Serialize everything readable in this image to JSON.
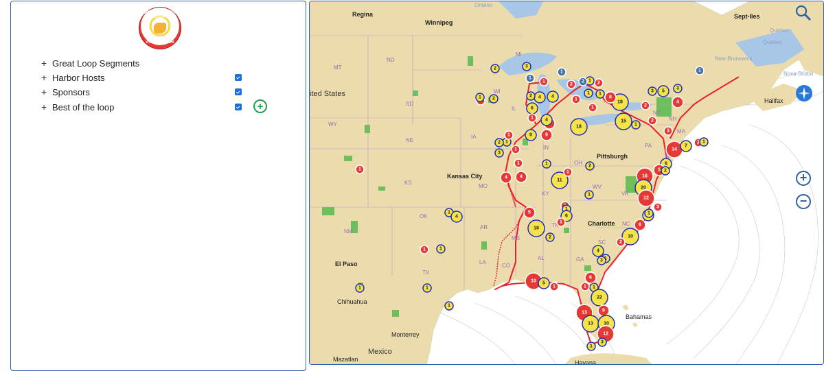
{
  "logo": {
    "top_text": "AMERICA'S GREAT LOOP",
    "bottom_text": "CRUISERS' ASSOCIATION"
  },
  "layers": [
    {
      "label": "Great Loop Segments",
      "checkbox": null
    },
    {
      "label": "Harbor Hosts",
      "checkbox": true
    },
    {
      "label": "Sponsors",
      "checkbox": true
    },
    {
      "label": "Best of the loop",
      "checkbox": true
    }
  ],
  "add_button": "+",
  "colors": {
    "land": "#ecdcad",
    "water": "#ffffff",
    "lake": "#a8c7e6",
    "route": "#e8202a",
    "harbor_host": "#e53935",
    "sponsor": "#4a6fa5",
    "best_of_loop": "#f6e34a",
    "park": "#6cbf5b"
  },
  "map": {
    "cities": [
      "Regina",
      "Winnipeg",
      "Sept-Iles",
      "Kansas City",
      "Pittsburgh",
      "Charlotte",
      "El Paso",
      "Chihuahua",
      "Monterrey",
      "Mexico",
      "Mazatlan",
      "Halifax",
      "Havana",
      "Bahamas",
      "Ontario",
      "Quebec",
      "Quebec",
      "New Brunswick",
      "Nova Scotia",
      "ited States"
    ],
    "states": [
      "MT",
      "ND",
      "MI",
      "SD",
      "WY",
      "WI",
      "NE",
      "IA",
      "IN",
      "OH",
      "PA",
      "NY",
      "NH",
      "MA",
      "NJ",
      "KS",
      "MO",
      "KY",
      "WV",
      "VA",
      "NM",
      "OK",
      "AR",
      "TN",
      "NC",
      "SC",
      "MS",
      "AL",
      "GA",
      "TX",
      "LA",
      "CO",
      "IL"
    ],
    "markers": [
      {
        "kind": "best",
        "n": "2"
      },
      {
        "kind": "best",
        "n": "3"
      },
      {
        "kind": "sponsor",
        "n": "1"
      },
      {
        "kind": "host",
        "n": "1"
      },
      {
        "kind": "best",
        "n": "1"
      },
      {
        "kind": "host",
        "n": "2"
      },
      {
        "kind": "sponsor",
        "n": "2"
      },
      {
        "kind": "host",
        "n": "2"
      },
      {
        "kind": "best",
        "n": "1"
      },
      {
        "kind": "best",
        "n": "1"
      },
      {
        "kind": "host",
        "n": "1"
      },
      {
        "kind": "host",
        "n": "1"
      },
      {
        "kind": "best",
        "n": "4"
      },
      {
        "kind": "best",
        "n": "4"
      },
      {
        "kind": "best",
        "n": "6"
      },
      {
        "kind": "host",
        "n": "1"
      },
      {
        "kind": "host",
        "n": "4"
      },
      {
        "kind": "best",
        "n": "18"
      },
      {
        "kind": "host",
        "n": "8"
      },
      {
        "kind": "best",
        "n": "18"
      },
      {
        "kind": "best",
        "n": "15"
      },
      {
        "kind": "host",
        "n": "2"
      },
      {
        "kind": "host",
        "n": "2"
      },
      {
        "kind": "best",
        "n": "3"
      },
      {
        "kind": "best",
        "n": "5"
      },
      {
        "kind": "best",
        "n": "3"
      },
      {
        "kind": "sponsor",
        "n": "1"
      },
      {
        "kind": "host",
        "n": "4"
      },
      {
        "kind": "host",
        "n": "9"
      },
      {
        "kind": "best",
        "n": "1"
      },
      {
        "kind": "best",
        "n": "3"
      },
      {
        "kind": "host",
        "n": "4"
      },
      {
        "kind": "host",
        "n": "1"
      },
      {
        "kind": "host",
        "n": "1"
      },
      {
        "kind": "host",
        "n": "4"
      },
      {
        "kind": "best",
        "n": "6"
      },
      {
        "kind": "host",
        "n": "3"
      },
      {
        "kind": "best",
        "n": "1"
      },
      {
        "kind": "host",
        "n": "14"
      },
      {
        "kind": "best",
        "n": "7"
      },
      {
        "kind": "host",
        "n": "2"
      },
      {
        "kind": "best",
        "n": "1"
      },
      {
        "kind": "host",
        "n": "16"
      },
      {
        "kind": "host",
        "n": "5"
      },
      {
        "kind": "best",
        "n": "2"
      },
      {
        "kind": "best",
        "n": "20"
      },
      {
        "kind": "host",
        "n": "12"
      },
      {
        "kind": "best",
        "n": "4"
      },
      {
        "kind": "best",
        "n": "1"
      },
      {
        "kind": "best",
        "n": "1"
      },
      {
        "kind": "best",
        "n": "11"
      },
      {
        "kind": "host",
        "n": "1"
      },
      {
        "kind": "best",
        "n": "1"
      },
      {
        "kind": "best",
        "n": "2"
      },
      {
        "kind": "host",
        "n": "1"
      },
      {
        "kind": "host",
        "n": "5"
      },
      {
        "kind": "best",
        "n": "1"
      },
      {
        "kind": "best",
        "n": "18"
      },
      {
        "kind": "best",
        "n": "6"
      },
      {
        "kind": "host",
        "n": "1"
      },
      {
        "kind": "best",
        "n": "2"
      },
      {
        "kind": "host",
        "n": "6"
      },
      {
        "kind": "host",
        "n": "3"
      },
      {
        "kind": "best",
        "n": "10"
      },
      {
        "kind": "host",
        "n": "2"
      },
      {
        "kind": "best",
        "n": "1"
      },
      {
        "kind": "best",
        "n": "4"
      },
      {
        "kind": "best",
        "n": "3"
      },
      {
        "kind": "best",
        "n": "1"
      },
      {
        "kind": "host",
        "n": "1"
      },
      {
        "kind": "host",
        "n": "10"
      },
      {
        "kind": "best",
        "n": "5"
      },
      {
        "kind": "host",
        "n": "6"
      },
      {
        "kind": "host",
        "n": "1"
      },
      {
        "kind": "best",
        "n": "22"
      },
      {
        "kind": "host",
        "n": "13"
      },
      {
        "kind": "host",
        "n": "9"
      },
      {
        "kind": "best",
        "n": "13"
      },
      {
        "kind": "best",
        "n": "10"
      },
      {
        "kind": "host",
        "n": "12"
      },
      {
        "kind": "best",
        "n": "3"
      },
      {
        "kind": "best",
        "n": "1"
      },
      {
        "kind": "best",
        "n": "1"
      },
      {
        "kind": "best",
        "n": "1"
      },
      {
        "kind": "best",
        "n": "1"
      },
      {
        "kind": "host",
        "n": "1"
      },
      {
        "kind": "best",
        "n": "1"
      },
      {
        "kind": "best",
        "n": "1"
      },
      {
        "kind": "best",
        "n": "4"
      },
      {
        "kind": "host",
        "n": "1"
      },
      {
        "kind": "best",
        "n": "1"
      },
      {
        "kind": "best",
        "n": "2"
      },
      {
        "kind": "best",
        "n": "2"
      },
      {
        "kind": "sponsor",
        "n": "1"
      },
      {
        "kind": "host",
        "n": "1"
      },
      {
        "kind": "best",
        "n": "9"
      },
      {
        "kind": "best",
        "n": "4"
      },
      {
        "kind": "host",
        "n": "1"
      },
      {
        "kind": "best",
        "n": "2"
      }
    ]
  }
}
